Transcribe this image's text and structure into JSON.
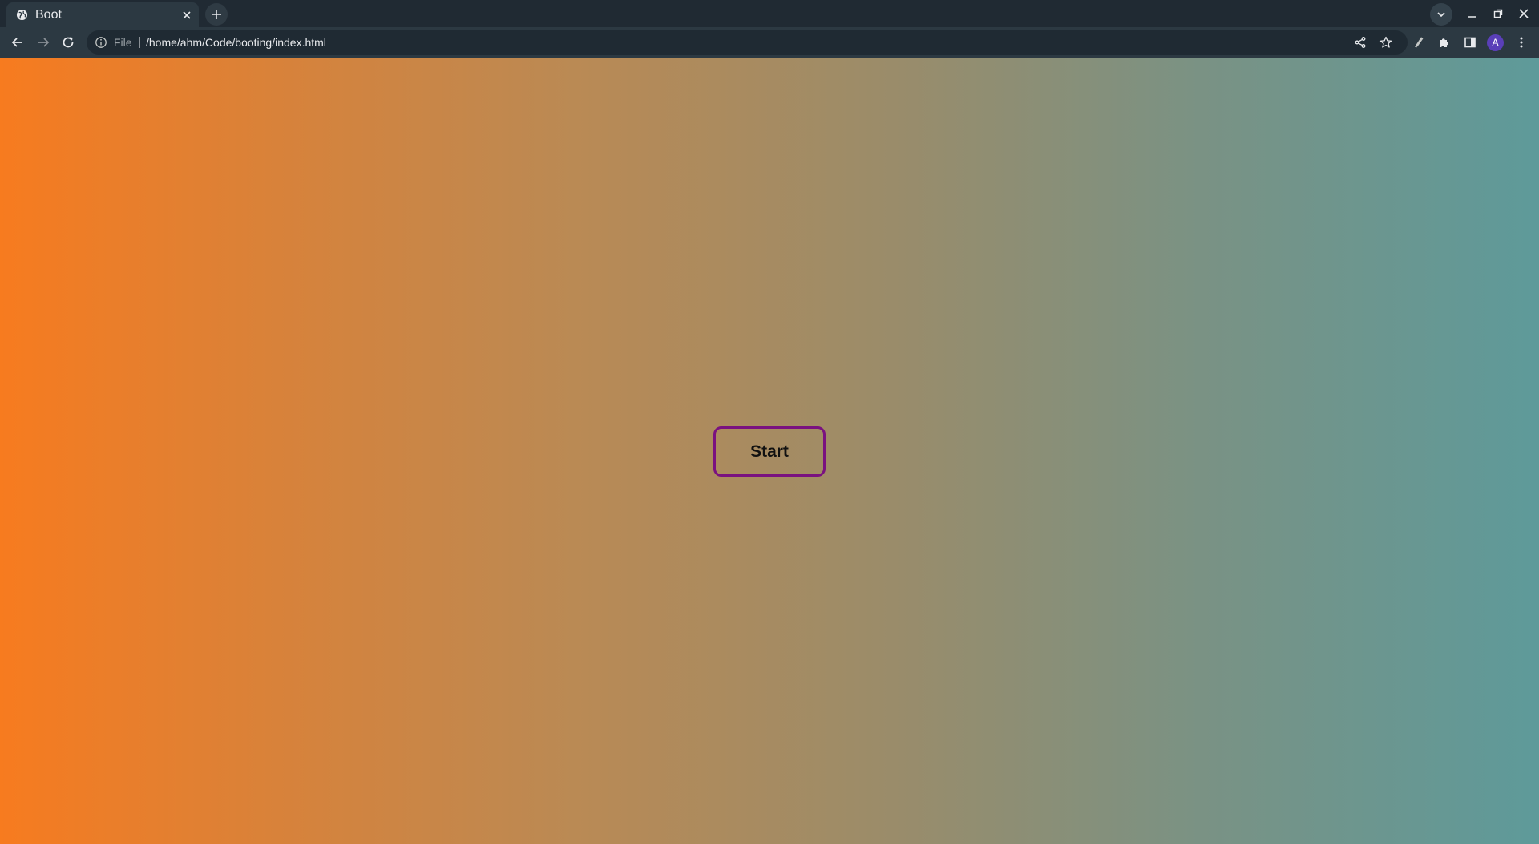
{
  "browser": {
    "tab": {
      "title": "Boot"
    },
    "address_bar": {
      "scheme_label": "File",
      "url": "/home/ahm/Code/booting/index.html"
    },
    "profile_initial": "A",
    "icons": {
      "favicon": "globe-icon",
      "tab_close": "close-icon",
      "new_tab": "plus-icon",
      "tab_search": "chevron-down-icon",
      "back": "back-arrow-icon",
      "forward": "forward-arrow-icon",
      "reload": "reload-icon",
      "site_info": "info-icon",
      "share": "share-icon",
      "bookmark": "star-icon",
      "extension": "extension-icon",
      "extensions_menu": "puzzle-icon",
      "side_panel": "side-panel-icon",
      "menu": "kebab-menu-icon"
    }
  },
  "page": {
    "start_button_label": "Start"
  },
  "colors": {
    "tabbar_bg": "#202a33",
    "toolbar_bg": "#2c3942",
    "gradient_start": "#f77b1f",
    "gradient_end": "#5e9a9a",
    "button_border": "#7a1180",
    "avatar_bg": "#5a3fb8"
  }
}
